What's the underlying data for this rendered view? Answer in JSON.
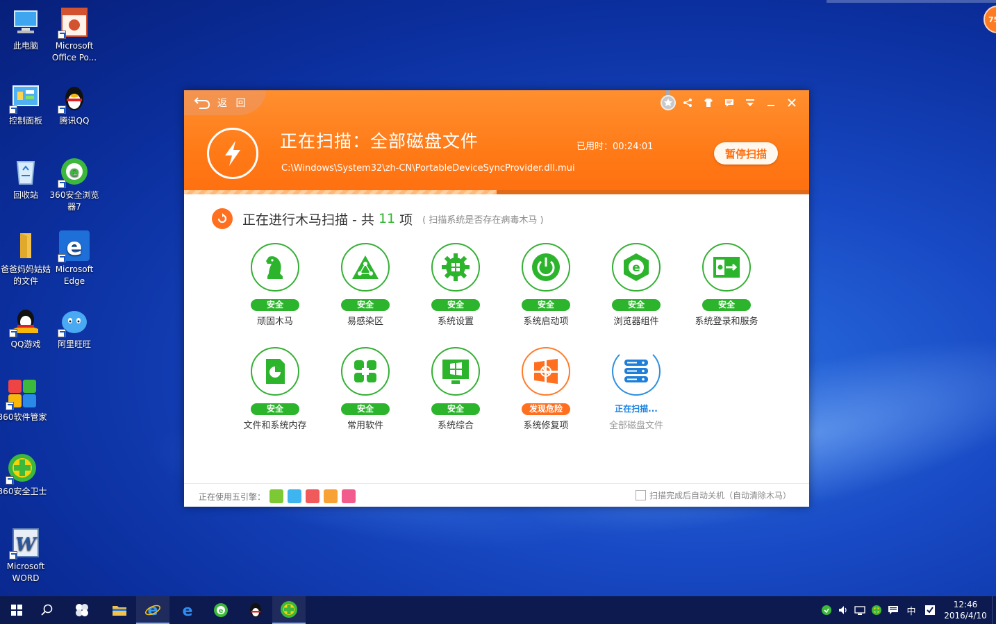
{
  "desktop": {
    "icons": [
      {
        "name": "此电脑",
        "icon": "computer-icon"
      },
      {
        "name": "Microsoft Office Po...",
        "icon": "powerpoint-icon"
      },
      {
        "name": "控制面板",
        "icon": "control-panel-icon"
      },
      {
        "name": "腾讯QQ",
        "icon": "qq-penguin-icon"
      },
      {
        "name": "回收站",
        "icon": "recycle-bin-icon"
      },
      {
        "name": "360安全浏览器7",
        "icon": "360-browser-icon"
      },
      {
        "name": "爸爸妈妈姑姑的文件",
        "icon": "folder-icon"
      },
      {
        "name": "Microsoft Edge",
        "icon": "edge-icon"
      },
      {
        "name": "QQ游戏",
        "icon": "qq-game-icon"
      },
      {
        "name": "阿里旺旺",
        "icon": "aliwangwang-icon"
      },
      {
        "name": "360软件管家",
        "icon": "360-software-manager-icon"
      },
      {
        "name": "360安全卫士",
        "icon": "360-security-icon"
      },
      {
        "name": "Microsoft WORD",
        "icon": "word-icon"
      }
    ],
    "corner_badge": "75"
  },
  "window": {
    "back_label": "返 回",
    "scan_title": "正在扫描：全部磁盘文件",
    "scan_path": "C:\\Windows\\System32\\zh-CN\\PortableDeviceSyncProvider.dll.mui",
    "elapsed": "已用时：00:24:01",
    "pause_button": "暂停扫描",
    "progress": 0.5,
    "controls": [
      "medal-icon",
      "share-icon",
      "skin-icon",
      "message-icon",
      "menu-icon",
      "minimize-icon",
      "close-icon"
    ],
    "section": {
      "prefix": "正在进行木马扫描 - 共",
      "count": "11",
      "suffix": "项",
      "hint": "( 扫描系统是否存在病毒木马 )"
    },
    "items": [
      {
        "label": "顽固木马",
        "status": "安全",
        "icon": "knight-icon",
        "state": "safe"
      },
      {
        "label": "易感染区",
        "status": "安全",
        "icon": "network-triangle-icon",
        "state": "safe"
      },
      {
        "label": "系统设置",
        "status": "安全",
        "icon": "gear-icon",
        "state": "safe"
      },
      {
        "label": "系统启动项",
        "status": "安全",
        "icon": "power-icon",
        "state": "safe"
      },
      {
        "label": "浏览器组件",
        "status": "安全",
        "icon": "browser-icon",
        "state": "safe"
      },
      {
        "label": "系统登录和服务",
        "status": "安全",
        "icon": "login-service-icon",
        "state": "safe"
      },
      {
        "label": "文件和系统内存",
        "status": "安全",
        "icon": "file-memory-icon",
        "state": "safe"
      },
      {
        "label": "常用软件",
        "status": "安全",
        "icon": "apps-grid-icon",
        "state": "safe"
      },
      {
        "label": "系统综合",
        "status": "安全",
        "icon": "windows-monitor-icon",
        "state": "safe"
      },
      {
        "label": "系统修复项",
        "status": "发现危险",
        "icon": "windows-repair-icon",
        "state": "danger"
      },
      {
        "label": "全部磁盘文件",
        "status": "正在扫描...",
        "icon": "disk-stack-icon",
        "state": "scan"
      }
    ],
    "footer": {
      "engines_label": "正在使用五引擎：",
      "engines": [
        {
          "icon": "cloud-engine-icon",
          "color": "#7cc934"
        },
        {
          "icon": "qvm-engine-icon",
          "color": "#3fb5f0"
        },
        {
          "icon": "bitdefender-engine-icon",
          "color": "#f05a5a"
        },
        {
          "icon": "system-repair-engine-icon",
          "color": "#f8a236"
        },
        {
          "icon": "avira-engine-icon",
          "color": "#f25c8c"
        }
      ],
      "auto_shutdown": "扫描完成后自动关机（自动清除木马）"
    }
  },
  "taskbar": {
    "items": [
      "start-icon",
      "search-icon",
      "task-view-icon",
      "file-explorer-icon",
      "ie-icon",
      "edge-icon",
      "360-browser-icon",
      "qq-icon",
      "360-security-icon"
    ],
    "tray": [
      "360-tray-icon",
      "volume-icon",
      "network-icon",
      "360-guard-tray-icon",
      "action-center-icon"
    ],
    "ime": "中",
    "time": "12:46",
    "date": "2016/4/10"
  }
}
